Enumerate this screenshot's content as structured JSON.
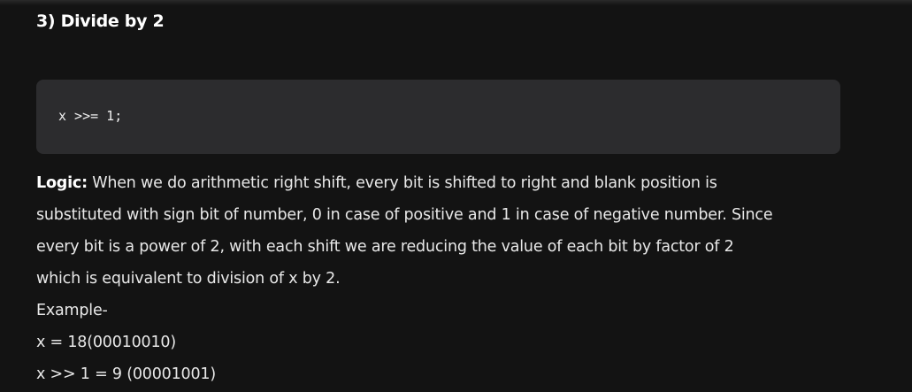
{
  "section": {
    "heading": "3) Divide by 2"
  },
  "code": {
    "text": "x >>= 1;"
  },
  "logic": {
    "label": "Logic:",
    "lines": [
      " When we do arithmetic right shift, every bit is shifted to right and blank position is",
      "substituted with sign bit of number, 0 in case of positive and 1 in case of negative number. Since",
      "every bit is a power of 2, with each shift we are reducing the value of each bit by factor of 2",
      "which is equivalent to division of x by 2."
    ]
  },
  "example": {
    "label": "Example-",
    "lines": [
      "x = 18(00010010)",
      "x >> 1 = 9 (00001001)"
    ]
  }
}
